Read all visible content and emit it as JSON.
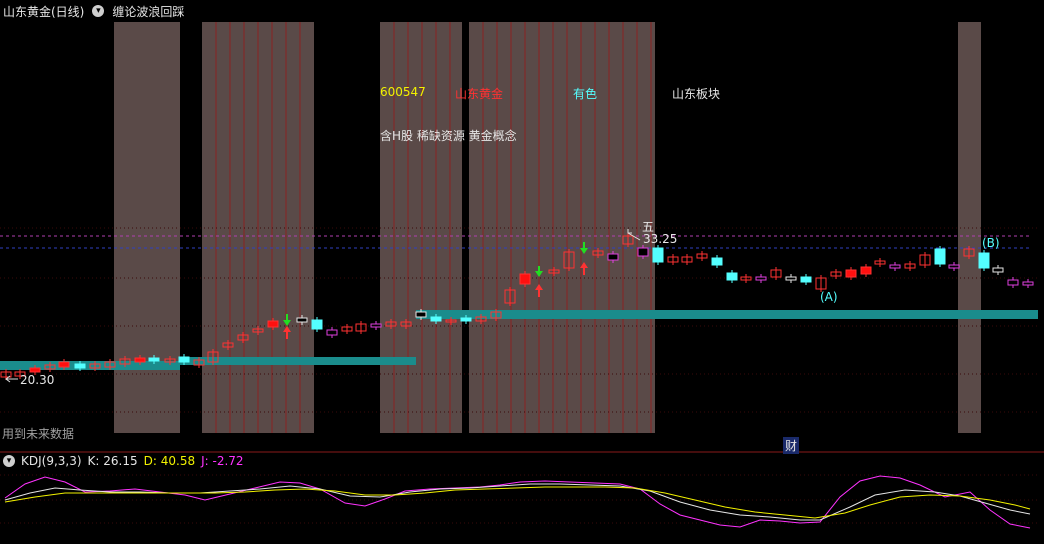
{
  "header": {
    "title": "山东黄金(日线)",
    "indicator": "缠论波浪回踩"
  },
  "stock_tags": {
    "code": "600547",
    "name": "山东黄金",
    "sector": "有色",
    "region": "山东板块",
    "concepts": "含H股 稀缺资源 黄金概念"
  },
  "annotations": {
    "low_price": "20.30",
    "high_marker": "五",
    "high_price": "33.25",
    "wave_a": "(A)",
    "wave_b": "(B)",
    "future_data_notice": "用到未来数据",
    "finance_badge": "财"
  },
  "kdj": {
    "label": "KDJ(9,3,3)",
    "k": "K: 26.15",
    "d": "D: 40.58",
    "j": "J: -2.72"
  },
  "colors": {
    "up": "#ff3232",
    "down": "#54ffff",
    "band": "#1a8c8c",
    "shade": "#5a4a48",
    "magenta": "#ff33ff",
    "yellow": "#f2f200",
    "white": "#e6e6e6"
  }
}
